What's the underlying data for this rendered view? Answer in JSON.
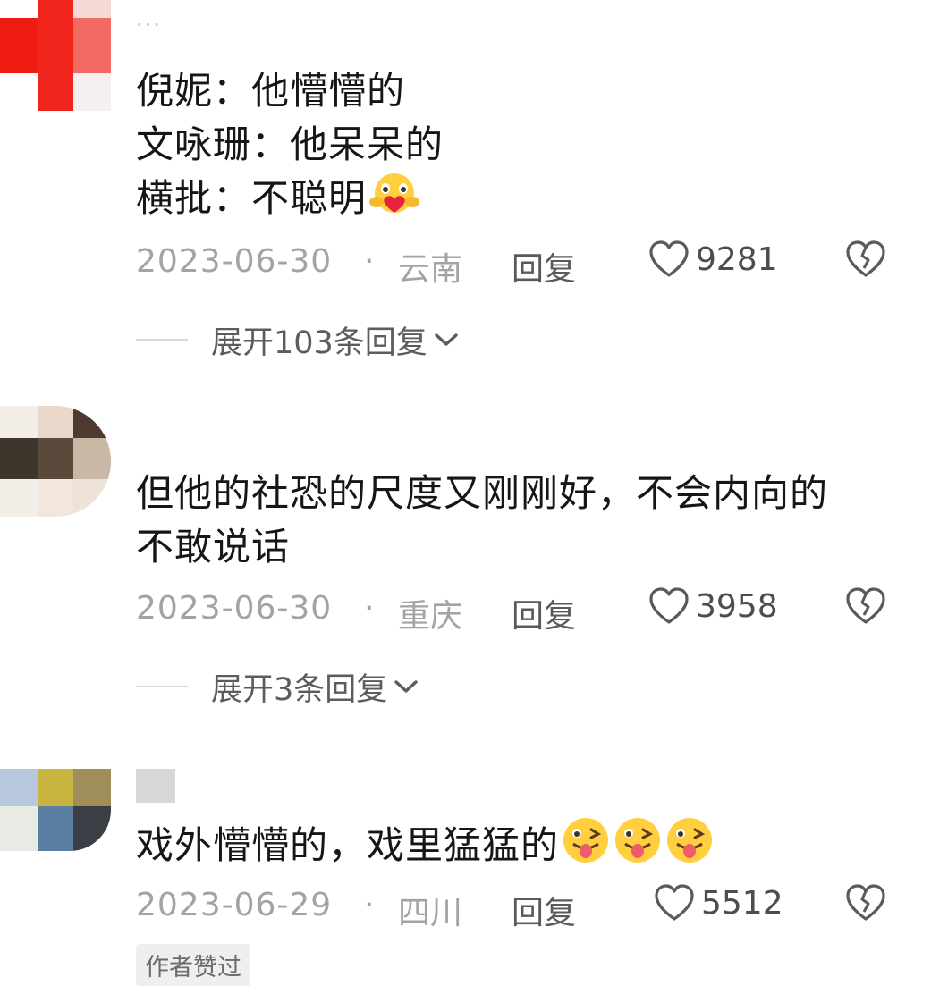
{
  "more_icon_glyph": "···",
  "comments": [
    {
      "content_lines": [
        "倪妮：他懵懵的",
        "文咏珊：他呆呆的",
        "横批：不聪明"
      ],
      "emoji": [
        "hug-heart-emoji"
      ],
      "date": "2023-06-30",
      "separator": "·",
      "location": "云南",
      "reply_label": "回复",
      "likes": "9281",
      "expand_label": "展开103条回复"
    },
    {
      "content_lines": [
        "但他的社恐的尺度又刚刚好，不会内向的",
        "不敢说话"
      ],
      "emoji": [],
      "date": "2023-06-30",
      "separator": "·",
      "location": "重庆",
      "reply_label": "回复",
      "likes": "3958",
      "expand_label": "展开3条回复"
    },
    {
      "content_lines": [
        "戏外懵懵的，戏里猛猛的"
      ],
      "emoji": [
        "tongue-wink-emoji",
        "tongue-wink-emoji",
        "tongue-wink-emoji"
      ],
      "date": "2023-06-29",
      "separator": "·",
      "location": "四川",
      "reply_label": "回复",
      "likes": "5512",
      "badge": "作者赞过"
    }
  ],
  "colors": {
    "meta_gray": "#a3a3a3",
    "reply_gray": "#5a5a5a",
    "badge_bg": "#efefef"
  }
}
